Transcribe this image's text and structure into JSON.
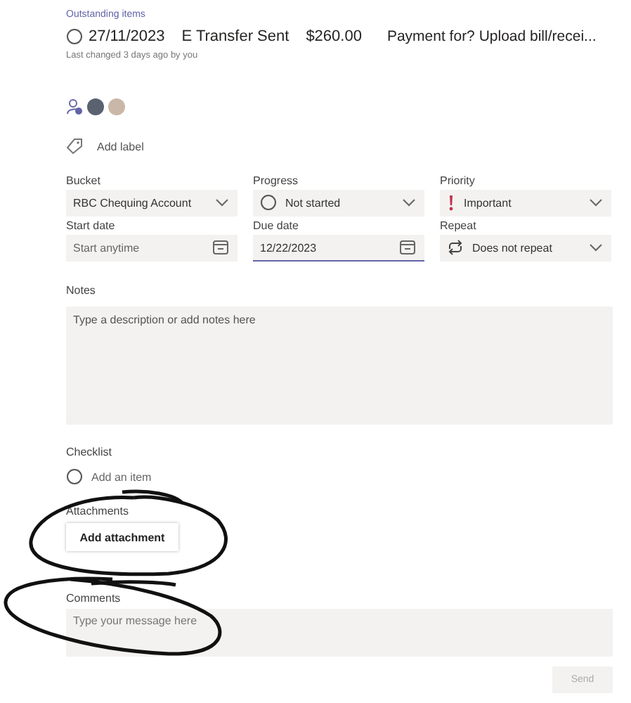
{
  "breadcrumb": "Outstanding items",
  "task": {
    "completed": false,
    "title_parts": [
      "27/11/2023",
      "E Transfer Sent",
      "$260.00",
      "Payment for? Upload bill/recei..."
    ],
    "last_changed": "Last changed 3 days ago by you"
  },
  "label_button": "Add label",
  "fields": [
    {
      "label": "Bucket",
      "kind": "dropdown",
      "value": "RBC Chequing Account"
    },
    {
      "label": "Progress",
      "kind": "status",
      "value": "Not started"
    },
    {
      "label": "Priority",
      "kind": "priority",
      "value": "Important"
    },
    {
      "label": "Start date",
      "kind": "date",
      "placeholder": "Start anytime",
      "focused": false
    },
    {
      "label": "Due date",
      "kind": "date",
      "value": "12/22/2023",
      "focused": true
    },
    {
      "label": "Repeat",
      "kind": "repeat",
      "value": "Does not repeat"
    }
  ],
  "notes": {
    "label": "Notes",
    "placeholder": "Type a description or add notes here"
  },
  "checklist": {
    "label": "Checklist",
    "add_placeholder": "Add an item"
  },
  "attachments": {
    "label": "Attachments",
    "button": "Add attachment"
  },
  "comments": {
    "label": "Comments",
    "placeholder": "Type your message here",
    "send": "Send",
    "send_disabled": true
  }
}
